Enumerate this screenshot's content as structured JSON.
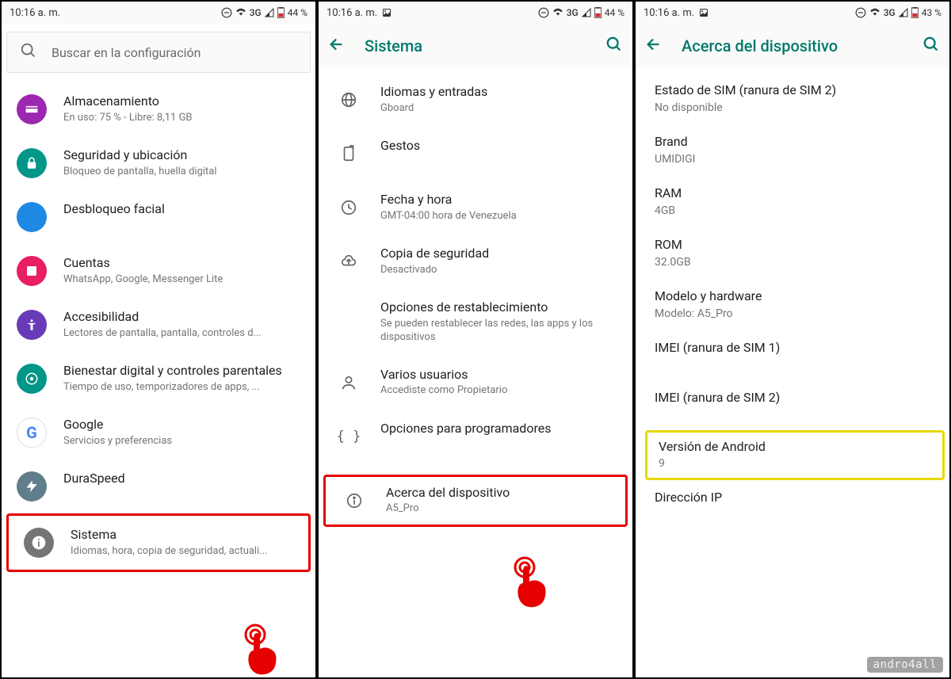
{
  "status": {
    "time1": "10:16 a. m.",
    "time2": "10:16 a. m.",
    "time3": "10:16 a. m.",
    "net": "3G",
    "batt1": "44 %",
    "batt2": "44 %",
    "batt3": "43 %"
  },
  "screen1": {
    "search_placeholder": "Buscar en la configuración",
    "items": {
      "storage": {
        "title": "Almacenamiento",
        "sub": "En uso: 75 % - Libre: 8,11 GB"
      },
      "security": {
        "title": "Seguridad y ubicación",
        "sub": "Bloqueo de pantalla, huella digital"
      },
      "face": {
        "title": "Desbloqueo facial",
        "sub": ""
      },
      "accounts": {
        "title": "Cuentas",
        "sub": "WhatsApp, Google, Messenger Lite"
      },
      "accessibility": {
        "title": "Accesibilidad",
        "sub": "Lectores de pantalla, pantalla, controles d..."
      },
      "wellbeing": {
        "title": "Bienestar digital y controles parentales",
        "sub": "Tiempo de uso, temporizadores de apps, ..."
      },
      "google": {
        "title": "Google",
        "sub": "Servicios y preferencias"
      },
      "duraspeed": {
        "title": "DuraSpeed",
        "sub": ""
      },
      "system": {
        "title": "Sistema",
        "sub": "Idiomas, hora, copia de seguridad, actuali..."
      }
    }
  },
  "screen2": {
    "title": "Sistema",
    "items": {
      "lang": {
        "title": "Idiomas y entradas",
        "sub": "Gboard"
      },
      "gestures": {
        "title": "Gestos",
        "sub": ""
      },
      "datetime": {
        "title": "Fecha y hora",
        "sub": "GMT-04:00 hora de Venezuela"
      },
      "backup": {
        "title": "Copia de seguridad",
        "sub": "Desactivado"
      },
      "reset": {
        "title": "Opciones de restablecimiento",
        "sub": "Se pueden restablecer las redes, las apps y los dispositivos"
      },
      "users": {
        "title": "Varios usuarios",
        "sub": "Accediste como Propietario"
      },
      "dev": {
        "title": "Opciones para programadores",
        "sub": ""
      },
      "about": {
        "title": "Acerca del dispositivo",
        "sub": "A5_Pro"
      }
    }
  },
  "screen3": {
    "title": "Acerca del dispositivo",
    "items": {
      "sim": {
        "title": "Estado de SIM (ranura de SIM 2)",
        "sub": "No disponible"
      },
      "brand": {
        "title": "Brand",
        "sub": "UMIDIGI"
      },
      "ram": {
        "title": "RAM",
        "sub": "4GB"
      },
      "rom": {
        "title": "ROM",
        "sub": "32.0GB"
      },
      "model": {
        "title": "Modelo y hardware",
        "sub": "Modelo: A5_Pro"
      },
      "imei1": {
        "title": "IMEI (ranura de SIM 1)",
        "sub": ""
      },
      "imei2": {
        "title": "IMEI (ranura de SIM 2)",
        "sub": ""
      },
      "android": {
        "title": "Versión de Android",
        "sub": "9"
      },
      "ip": {
        "title": "Dirección IP",
        "sub": ""
      }
    }
  },
  "watermark": "andro4all"
}
